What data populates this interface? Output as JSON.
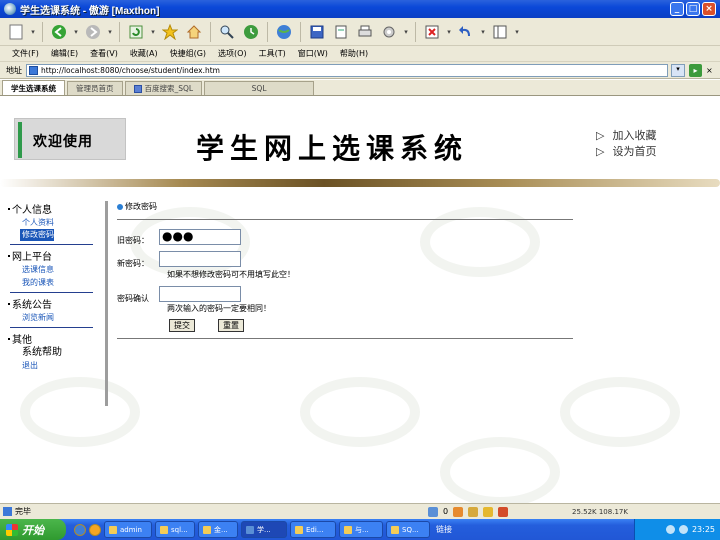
{
  "window": {
    "title": "学生选课系统 - 傲游 [Maxthon]",
    "controls": [
      "_",
      "□",
      "×"
    ]
  },
  "toolbar": {
    "icons": [
      "new-page-icon",
      "back-icon",
      "forward-icon",
      "refresh-icon",
      "favorites-icon",
      "home-icon",
      "search-icon",
      "history-icon",
      "globe-icon",
      "save-icon",
      "page-icon",
      "print-icon",
      "tools-icon",
      "close-page-icon",
      "undo-icon",
      "view-icon"
    ]
  },
  "menu": {
    "items": [
      "文件(F)",
      "编辑(E)",
      "查看(V)",
      "收藏(A)",
      "快捷组(G)",
      "选项(O)",
      "工具(T)",
      "窗口(W)",
      "帮助(H)"
    ]
  },
  "address": {
    "label": "地址",
    "url": "http://localhost:8080/choose/student/index.htm"
  },
  "tabs": [
    {
      "label": "学生选课系统",
      "active": true
    },
    {
      "label": "管理员首页",
      "active": false
    },
    {
      "label": "百度搜索_SQL",
      "active": false
    },
    {
      "label": "SQL",
      "active": false
    }
  ],
  "banner": {
    "welcome": "欢迎使用",
    "title": "学生网上选课系统",
    "add_favorite": "加入收藏",
    "set_home": "设为首页"
  },
  "sidebar": {
    "groups": [
      {
        "title": "个人信息",
        "items": [
          "个人资料",
          "修改密码"
        ]
      },
      {
        "title": "网上平台",
        "items": [
          "选课信息",
          "我的课表"
        ]
      },
      {
        "title": "系统公告",
        "items": [
          "浏览新闻"
        ]
      },
      {
        "title": "其他",
        "items": [
          "系统帮助",
          "退出"
        ]
      }
    ],
    "selected": "修改密码"
  },
  "form": {
    "breadcrumb": "修改密码",
    "old_label": "旧密码：",
    "old_value": "●●●",
    "new_label": "新密码：",
    "new_hint": "如果不想修改密码可不用填写此空！",
    "confirm_label": "密码确认",
    "confirm_hint": "两次输入的密码一定要相同！",
    "submit": "提交",
    "reset": "重置"
  },
  "status": {
    "text": "完毕",
    "count": "0",
    "right": "25.52K  108.17K"
  },
  "taskbar": {
    "start": "开始",
    "tasks": [
      "admin",
      "sql...",
      "金...",
      "学...",
      "Edi...",
      "与...",
      "SQ..."
    ],
    "active_task": "学...",
    "links": "链接",
    "time": "23:25"
  }
}
